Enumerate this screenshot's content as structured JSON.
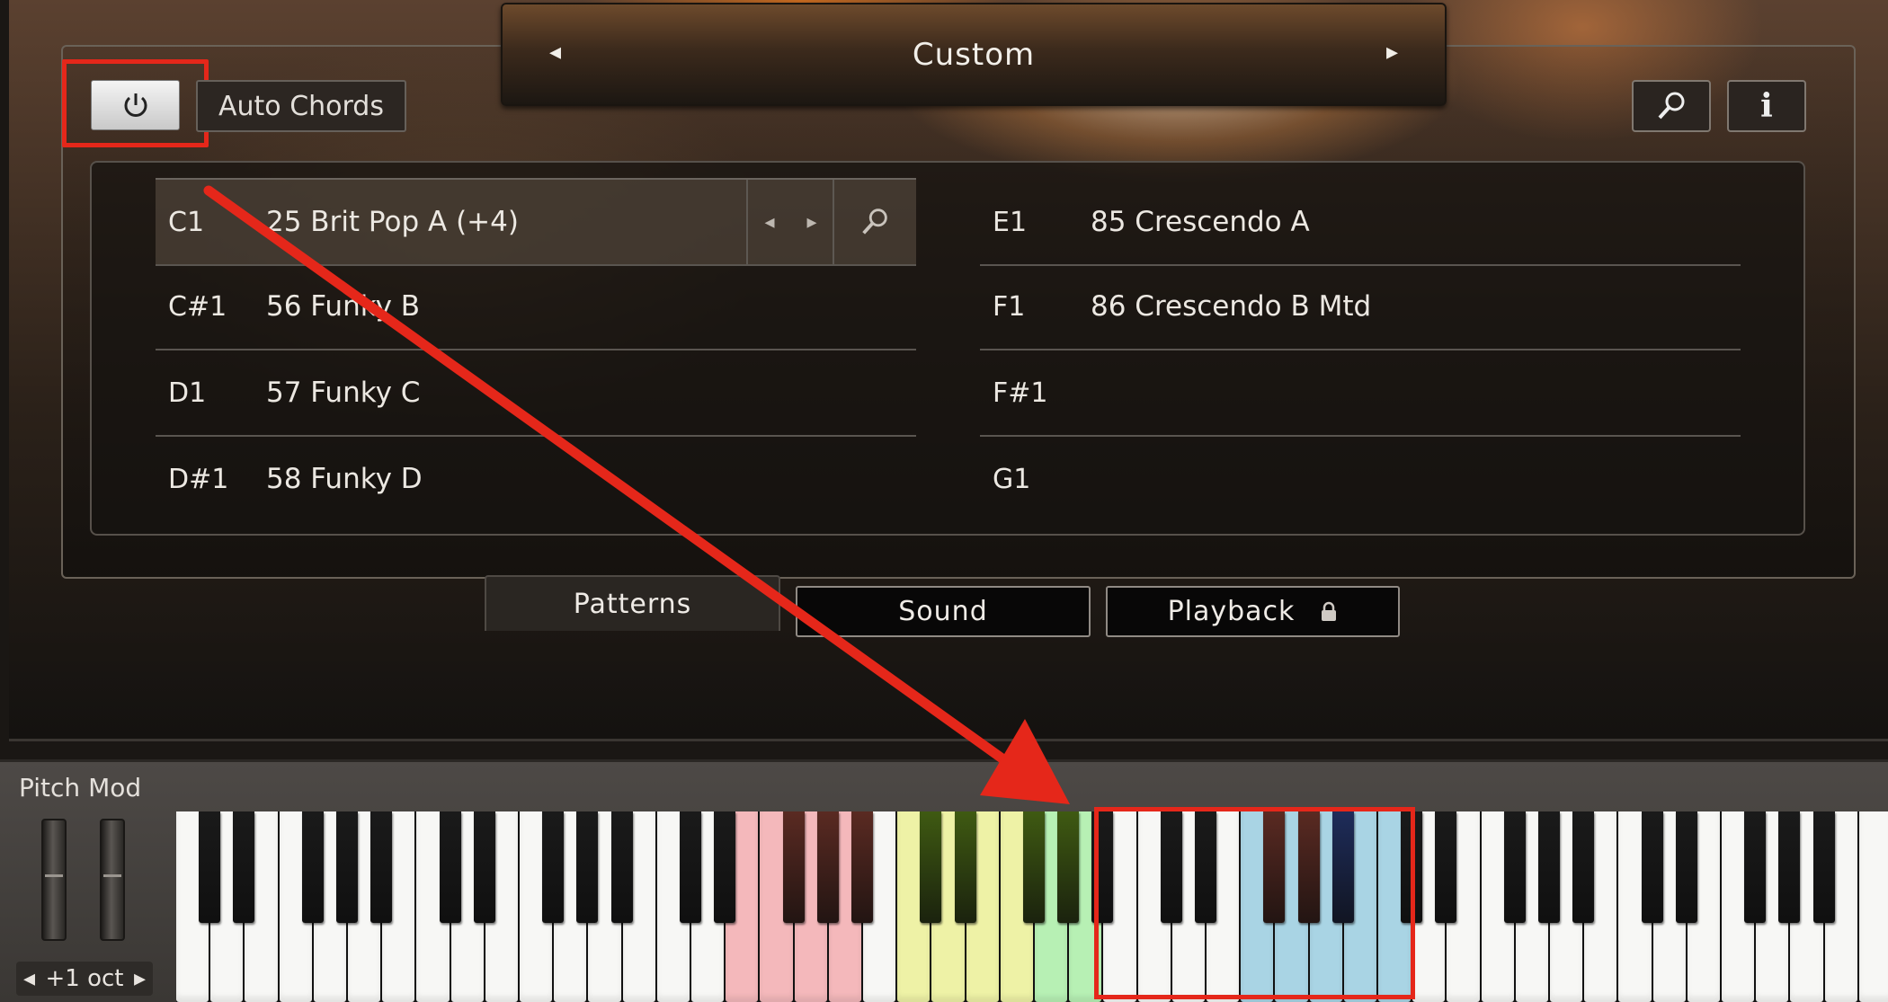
{
  "preset": {
    "name": "Custom",
    "prev": "◂",
    "next": "▸"
  },
  "header": {
    "auto_chords": "Auto Chords",
    "info": "i"
  },
  "patterns": {
    "left": [
      {
        "key": "C1",
        "pattern": "25 Brit Pop A (+4)"
      },
      {
        "key": "C#1",
        "pattern": "56 Funky B"
      },
      {
        "key": "D1",
        "pattern": "57 Funky C"
      },
      {
        "key": "D#1",
        "pattern": "58 Funky D"
      }
    ],
    "right": [
      {
        "key": "E1",
        "pattern": "85 Crescendo A"
      },
      {
        "key": "F1",
        "pattern": "86 Crescendo B Mtd"
      },
      {
        "key": "F#1",
        "pattern": ""
      },
      {
        "key": "G1",
        "pattern": ""
      }
    ],
    "row_controls": {
      "prev": "◂",
      "next": "▸"
    }
  },
  "tabs": {
    "patterns": "Patterns",
    "sound": "Sound",
    "playback": "Playback"
  },
  "keyboard": {
    "label": "Pitch Mod",
    "octave": "+1 oct",
    "octave_prev": "◂",
    "octave_next": "▸",
    "zone_colors": {
      "red": "#f4b8bb",
      "yellow": "#eef2a6",
      "green": "#b7f0b4",
      "blue": "#a9d4e4",
      "red_black": "#5a2a22",
      "green_black": "#3f5a12",
      "blue_black": "#1e2c5a"
    }
  },
  "annotation": {
    "color": "#e5271a"
  }
}
